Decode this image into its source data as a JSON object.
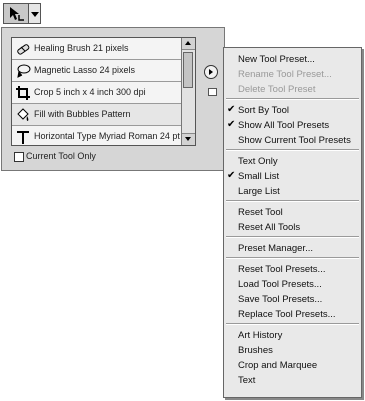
{
  "tool_button": {
    "icon": "crop-arrow-tool-icon"
  },
  "preset_list": {
    "items": [
      {
        "label": "Healing Brush 21 pixels",
        "icon": "healing-brush-icon"
      },
      {
        "label": "Magnetic Lasso 24 pixels",
        "icon": "magnetic-lasso-icon"
      },
      {
        "label": "Crop 5 inch x 4 inch 300 dpi",
        "icon": "crop-icon"
      },
      {
        "label": "Fill with Bubbles Pattern",
        "icon": "paint-bucket-icon"
      },
      {
        "label": "Horizontal Type Myriad Roman 24 pt",
        "icon": "type-icon"
      }
    ],
    "current_tool_only_label": "Current Tool Only",
    "current_tool_only_checked": false
  },
  "menu": {
    "items": [
      {
        "label": "New Tool Preset...",
        "checked": false,
        "disabled": false
      },
      {
        "label": "Rename Tool Preset...",
        "checked": false,
        "disabled": true
      },
      {
        "label": "Delete Tool Preset",
        "checked": false,
        "disabled": true
      },
      {
        "label": "Sort By Tool",
        "checked": true,
        "disabled": false
      },
      {
        "label": "Show All Tool Presets",
        "checked": true,
        "disabled": false
      },
      {
        "label": "Show Current Tool Presets",
        "checked": false,
        "disabled": false
      },
      {
        "label": "Text Only",
        "checked": false,
        "disabled": false
      },
      {
        "label": "Small List",
        "checked": true,
        "disabled": false
      },
      {
        "label": "Large List",
        "checked": false,
        "disabled": false
      },
      {
        "label": "Reset Tool",
        "checked": false,
        "disabled": false
      },
      {
        "label": "Reset All Tools",
        "checked": false,
        "disabled": false
      },
      {
        "label": "Preset Manager...",
        "checked": false,
        "disabled": false
      },
      {
        "label": "Reset Tool Presets...",
        "checked": false,
        "disabled": false
      },
      {
        "label": "Load Tool Presets...",
        "checked": false,
        "disabled": false
      },
      {
        "label": "Save Tool Presets...",
        "checked": false,
        "disabled": false
      },
      {
        "label": "Replace Tool Presets...",
        "checked": false,
        "disabled": false
      },
      {
        "label": "Art History",
        "checked": false,
        "disabled": false
      },
      {
        "label": "Brushes",
        "checked": false,
        "disabled": false
      },
      {
        "label": "Crop and Marquee",
        "checked": false,
        "disabled": false
      },
      {
        "label": "Text",
        "checked": false,
        "disabled": false
      }
    ],
    "check_mark": "✔"
  }
}
